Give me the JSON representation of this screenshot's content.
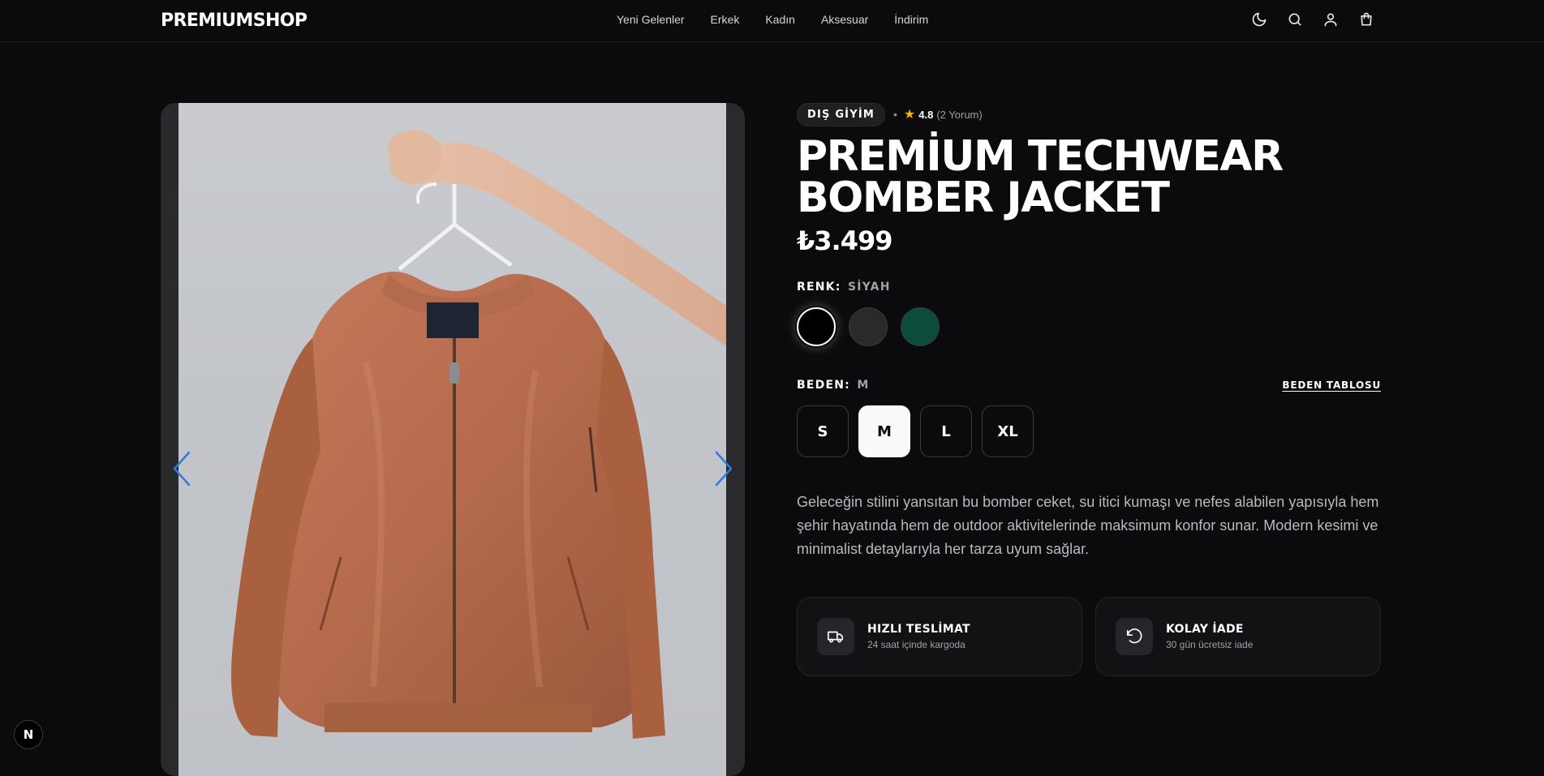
{
  "header": {
    "logo": "PREMIUMSHOP",
    "nav": [
      "Yeni Gelenler",
      "Erkek",
      "Kadın",
      "Aksesuar",
      "İndirim"
    ],
    "icons": [
      "moon-icon",
      "search-icon",
      "user-icon",
      "shopping-bag-icon"
    ]
  },
  "gallery": {
    "prev_icon": "chevron-left-icon",
    "next_icon": "chevron-right-icon"
  },
  "product": {
    "category": "DIŞ GİYİM",
    "separator": "•",
    "rating": "4.8",
    "reviews": "(2 Yorum)",
    "title_line1": "PREMİUM TECHWEAR",
    "title_line2": "BOMBER JACKET",
    "price": "₺3.499",
    "color_label": "RENK:",
    "color_value": "SİYAH",
    "colors": [
      "#000000",
      "#2a2a2d",
      "#0b4d3a"
    ],
    "size_label": "BEDEN:",
    "size_value": "M",
    "size_guide": "BEDEN TABLOSU",
    "sizes": [
      "S",
      "M",
      "L",
      "XL"
    ],
    "description": "Geleceğin stilini yansıtan bu bomber ceket, su itici kumaşı ve nefes alabilen yapısıyla hem şehir hayatında hem de outdoor aktivitelerinde maksimum konfor sunar. Modern kesimi ve minimalist detaylarıyla her tarza uyum sağlar."
  },
  "features": [
    {
      "icon": "truck-icon",
      "title": "HIZLI TESLİMAT",
      "subtitle": "24 saat içinde kargoda"
    },
    {
      "icon": "rotate-ccw-icon",
      "title": "KOLAY İADE",
      "subtitle": "30 gün ücretsiz iade"
    }
  ],
  "dev_badge": "N",
  "colors": {
    "background": "#0b0b0d",
    "accent_arrow": "#2d7be0",
    "star": "#f5b301"
  }
}
